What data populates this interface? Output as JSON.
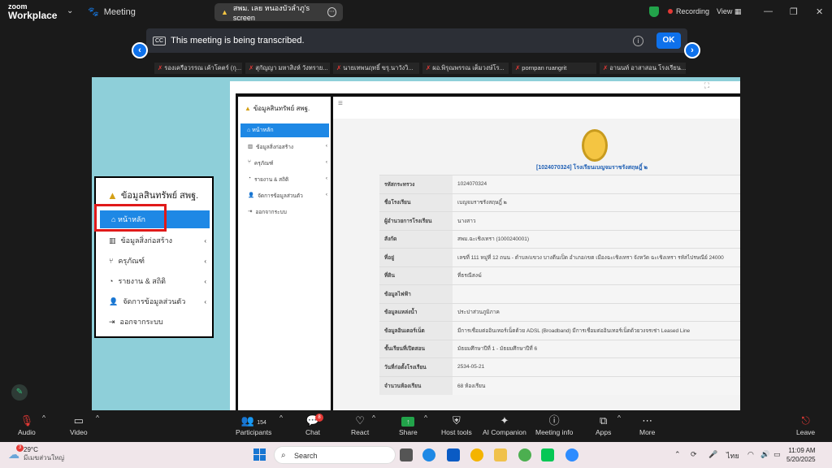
{
  "app": {
    "logo_line1": "zoom",
    "logo_line2": "Workplace",
    "meeting_label": "Meeting",
    "screen_title": "สพม. เลย หนองบัวลำภู's screen",
    "recording": "Recording",
    "view": "View"
  },
  "banner": {
    "text": "This meeting is being transcribed.",
    "ok": "OK"
  },
  "participants": [
    "รองเครือวรรณ เค้าโคตร์ (กุ...",
    "สุกัญญา มหาสิงห์ วังทราย...",
    "นายเทพนฤทธิ์ ขรุ.นาวังวิ...",
    "ผอ.พิรุณพรรณ เต็มวงษ์โร...",
    "pornpan ruangrit",
    "อานนท์ อาสาสอน โรงเรียน..."
  ],
  "zoomed_menu": {
    "title": "ข้อมูลสินทรัพย์ สพฐ.",
    "home": "หน้าหลัก",
    "items": [
      "ข้อมูลสิ่งก่อสร้าง",
      "ครุภัณฑ์",
      "รายงาน & สถิติ",
      "จัดการข้อมูลส่วนตัว",
      "ออกจากระบบ"
    ]
  },
  "sidebar": {
    "title": "ข้อมูลสินทรัพย์ สพฐ.",
    "home": "หน้าหลัก",
    "items": [
      "ข้อมูลสิ่งก่อสร้าง",
      "ครุภัณฑ์",
      "รายงาน & สถิติ",
      "จัดการข้อมูลส่วนตัว",
      "ออกจากระบบ"
    ]
  },
  "school": {
    "heading": "[1024070324] โรงเรียนเบญจมราชรังสฤษฎิ์ ๒",
    "rows": [
      {
        "k": "รหัสกระทรวง",
        "v": "1024070324"
      },
      {
        "k": "ชื่อโรงเรียน",
        "v": "เบญจมราชรังสฤษฎิ์ ๒"
      },
      {
        "k": "ผู้อำนวยการโรงเรียน",
        "v": "นางสาว"
      },
      {
        "k": "สังกัด",
        "v": "สพม.ฉะเชิงเทรา (1000240001)"
      },
      {
        "k": "ที่อยู่",
        "v": "เลขที่ 111 หมู่ที่ 12 ถนน - ตำบล/แขวง บางตีนเป็ด อำเภอ/เขต เมืองฉะเชิงเทรา จังหวัด ฉะเชิงเทรา รหัสไปรษณีย์ 24000"
      },
      {
        "k": "ที่ดิน",
        "v": "ที่ธรณีสงฆ์"
      },
      {
        "k": "ข้อมูลไฟฟ้า",
        "v": ""
      },
      {
        "k": "ข้อมูลแหล่งน้ำ",
        "v": "ประปาส่วนภูมิภาค"
      },
      {
        "k": "ข้อมูลอินเตอร์เน็ต",
        "v": "มีการเชื่อมต่ออินเทอร์เน็ตด้วย ADSL (Broadband) มีการเชื่อมต่ออินเทอร์เน็ตด้วยวงจรเช่า Leased Line"
      },
      {
        "k": "ชั้นเรียนที่เปิดสอน",
        "v": "มัธยมศึกษาปีที่ 1 - มัธยมศึกษาปีที่ 6"
      },
      {
        "k": "วันที่ก่อตั้งโรงเรียน",
        "v": "2534-05-21"
      },
      {
        "k": "จำนวนห้องเรียน",
        "v": "68 ห้องเรียน"
      }
    ]
  },
  "toolbar": {
    "audio": "Audio",
    "video": "Video",
    "participants": "Participants",
    "participants_count": "154",
    "chat": "Chat",
    "chat_badge": "8",
    "react": "React",
    "share": "Share",
    "host_tools": "Host tools",
    "ai": "AI Companion",
    "meeting_info": "Meeting info",
    "apps": "Apps",
    "more": "More",
    "leave": "Leave"
  },
  "taskbar": {
    "temp": "29°C",
    "weather_text": "มีเมฆส่วนใหญ่",
    "weather_badge": "3",
    "search": "Search",
    "lang": "ไทย",
    "time": "11:09 AM",
    "date": "5/20/2025"
  }
}
